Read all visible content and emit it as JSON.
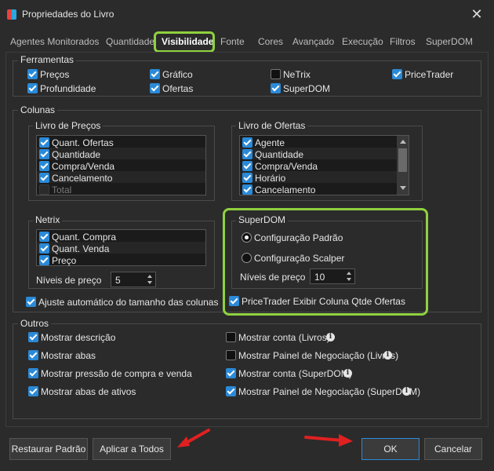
{
  "window": {
    "title": "Propriedades do Livro",
    "accent": "#2b8ad8",
    "highlight": "#8fd13f",
    "annotation": "#e02020"
  },
  "tabs": [
    "Agentes Monitorados",
    "Quantidade",
    "Visibilidade",
    "Fonte",
    "Cores",
    "Avançado",
    "Execução",
    "Filtros",
    "SuperDOM"
  ],
  "active_tab": "Visibilidade",
  "ferramentas": {
    "title": "Ferramentas",
    "items": [
      {
        "label": "Preços",
        "checked": true
      },
      {
        "label": "Gráfico",
        "checked": true
      },
      {
        "label": "NeTrix",
        "checked": false
      },
      {
        "label": "PriceTrader",
        "checked": true
      },
      {
        "label": "Profundidade",
        "checked": true
      },
      {
        "label": "Ofertas",
        "checked": true
      },
      {
        "label": "SuperDOM",
        "checked": true
      }
    ]
  },
  "colunas": {
    "title": "Colunas",
    "livro_precos": {
      "title": "Livro de Preços",
      "items": [
        {
          "label": "Quant. Ofertas",
          "checked": true
        },
        {
          "label": "Quantidade",
          "checked": true
        },
        {
          "label": "Compra/Venda",
          "checked": true
        },
        {
          "label": "Cancelamento",
          "checked": true
        },
        {
          "label": "Total",
          "checked": false
        }
      ]
    },
    "livro_ofertas": {
      "title": "Livro de Ofertas",
      "items": [
        {
          "label": "Agente",
          "checked": true
        },
        {
          "label": "Quantidade",
          "checked": true
        },
        {
          "label": "Compra/Venda",
          "checked": true
        },
        {
          "label": "Horário",
          "checked": true
        },
        {
          "label": "Cancelamento",
          "checked": true
        }
      ]
    },
    "netrix": {
      "title": "Netrix",
      "items": [
        {
          "label": "Quant. Compra",
          "checked": true
        },
        {
          "label": "Quant. Venda",
          "checked": true
        },
        {
          "label": "Preço",
          "checked": true
        }
      ],
      "niveis_label": "Níveis de preço",
      "niveis_value": "5"
    },
    "superdom": {
      "title": "SuperDOM",
      "options": [
        "Configuração Padrão",
        "Configuração Scalper"
      ],
      "selected": "Configuração Padrão",
      "niveis_label": "Níveis de preço",
      "niveis_value": "10",
      "pricetrader_label": "PriceTrader Exibir Coluna Qtde Ofertas",
      "pricetrader_checked": true
    },
    "ajuste_label": "Ajuste automático do tamanho das colunas",
    "ajuste_checked": true
  },
  "outros": {
    "title": "Outros",
    "left": [
      {
        "label": "Mostrar descrição",
        "checked": true
      },
      {
        "label": "Mostrar abas",
        "checked": true
      },
      {
        "label": "Mostrar pressão de compra e venda",
        "checked": true
      },
      {
        "label": "Mostrar abas de ativos",
        "checked": true
      }
    ],
    "right": [
      {
        "label": "Mostrar conta (Livros)",
        "checked": false
      },
      {
        "label": "Mostrar Painel de Negociação (Livros)",
        "checked": false
      },
      {
        "label": "Mostrar conta (SuperDOM)",
        "checked": true
      },
      {
        "label": "Mostrar Painel de Negociação (SuperDOM)",
        "checked": true
      }
    ]
  },
  "buttons": {
    "restaurar": "Restaurar Padrão",
    "aplicar": "Aplicar a Todos",
    "ok": "OK",
    "cancelar": "Cancelar"
  }
}
